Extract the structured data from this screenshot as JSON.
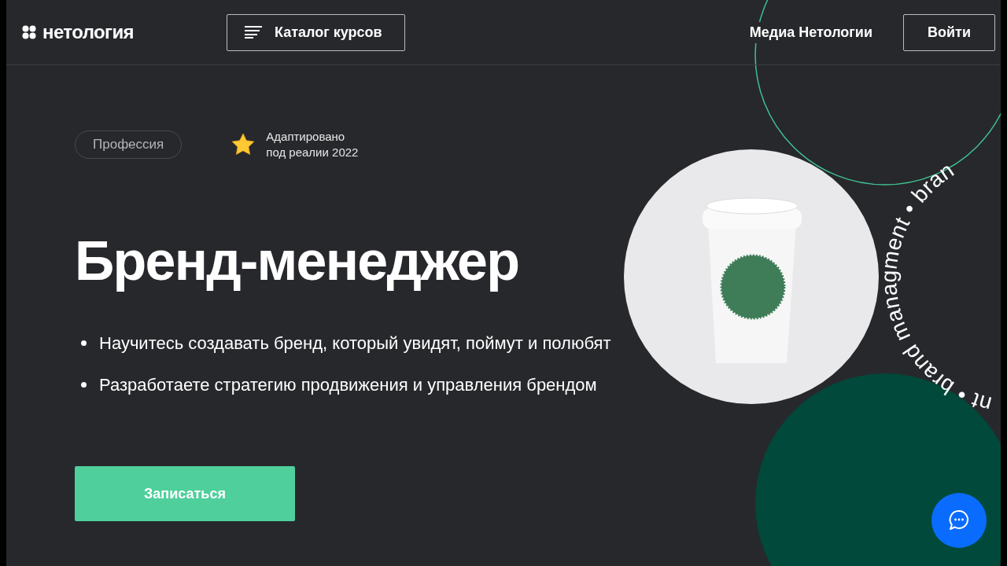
{
  "header": {
    "logo": "нетология",
    "catalog_button": "Каталог курсов",
    "media_link": "Медиа Нетологии",
    "login_button": "Войти"
  },
  "hero": {
    "tag": "Профессия",
    "badge": "Адаптировано\nпод реалии 2022",
    "title": "Бренд-менеджер",
    "bullets": [
      "Научитесь создавать бренд, который увидят, поймут и полюбят",
      "Разработаете стратегию продвижения и управления брендом"
    ],
    "cta": "Записаться"
  },
  "circle_text": "nt • brand managment • bran"
}
